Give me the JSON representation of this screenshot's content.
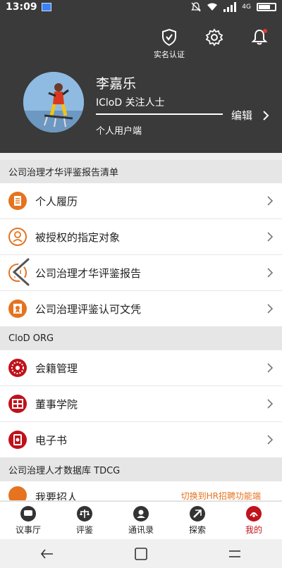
{
  "status_bar": {
    "time": "13:09",
    "network": "4G"
  },
  "header": {
    "verify_label": "实名认证",
    "user_name": "李嘉乐",
    "user_title": "ICloD 关注人士",
    "user_type": "个人用户端",
    "edit_label": "编辑"
  },
  "sections": [
    {
      "title": "公司治理才华评鉴报告清单",
      "items": [
        {
          "label": "个人履历",
          "icon": "document-icon"
        },
        {
          "label": "被授权的指定对象",
          "icon": "person-check-icon"
        },
        {
          "label": "公司治理才华评鉴报告",
          "icon": "report-icon"
        },
        {
          "label": "公司治理评鉴认可文凭",
          "icon": "certificate-icon"
        }
      ]
    },
    {
      "title": "CloD ORG",
      "items": [
        {
          "label": "会籍管理",
          "icon": "membership-icon"
        },
        {
          "label": "董事学院",
          "icon": "academy-icon"
        },
        {
          "label": "电子书",
          "icon": "ebook-icon"
        }
      ]
    },
    {
      "title": "公司治理人才数据库 TDCG",
      "items": [
        {
          "label": "我要招人",
          "icon": "recruit-icon",
          "note": "切换到HR招聘功能端"
        }
      ]
    }
  ],
  "tabbar": [
    {
      "label": "议事厅",
      "icon": "chat-icon"
    },
    {
      "label": "评鉴",
      "icon": "scale-icon"
    },
    {
      "label": "通讯录",
      "icon": "contacts-icon"
    },
    {
      "label": "探索",
      "icon": "compass-icon"
    },
    {
      "label": "我的",
      "icon": "profile-icon",
      "active": true
    }
  ],
  "colors": {
    "accent": "#c0121b",
    "orange": "#e5731f",
    "header_bg": "#3a3a3a"
  }
}
